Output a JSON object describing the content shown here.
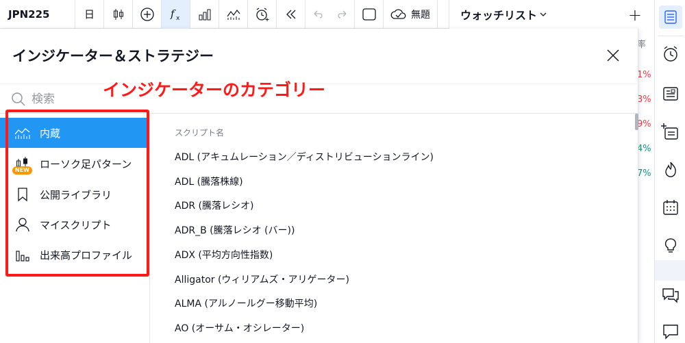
{
  "toolbar": {
    "symbol": "JPN225",
    "interval": "日",
    "save_label": "無題"
  },
  "watchlist": {
    "title": "ウォッチリスト",
    "col_header": "率",
    "changes": [
      {
        "text": "1%",
        "color": "#f23645"
      },
      {
        "text": "3%",
        "color": "#f23645"
      },
      {
        "text": "9%",
        "color": "#f23645"
      },
      {
        "text": "4%",
        "color": "#089981"
      },
      {
        "text": "7%",
        "color": "#089981"
      }
    ]
  },
  "dialog": {
    "title": "インジケーター＆ストラテジー",
    "search_placeholder": "検索",
    "categories": [
      {
        "label": "内蔵",
        "icon": "chart-line-icon",
        "active": true
      },
      {
        "label": "ローソク足パターン",
        "icon": "candlestick-icon",
        "badge": "NEW"
      },
      {
        "label": "公開ライブラリ",
        "icon": "bookmark-icon"
      },
      {
        "label": "マイスクリプト",
        "icon": "user-icon"
      },
      {
        "label": "出来高プロファイル",
        "icon": "bar-chart-icon"
      }
    ],
    "column_header": "スクリプト名",
    "scripts": [
      "ADL (アキュムレーション／ディストリビューションライン)",
      "ADL (騰落株線)",
      "ADR (騰落レシオ)",
      "ADR_B (騰落レシオ (バー))",
      "ADX (平均方向性指数)",
      "Alligator (ウィリアムズ・アリゲーター)",
      "ALMA (アルノールグー移動平均)",
      "AO (オーサム・オシレーター)"
    ]
  },
  "annotation": {
    "label": "インジケーターのカテゴリー",
    "color": "#ff1a1a"
  }
}
